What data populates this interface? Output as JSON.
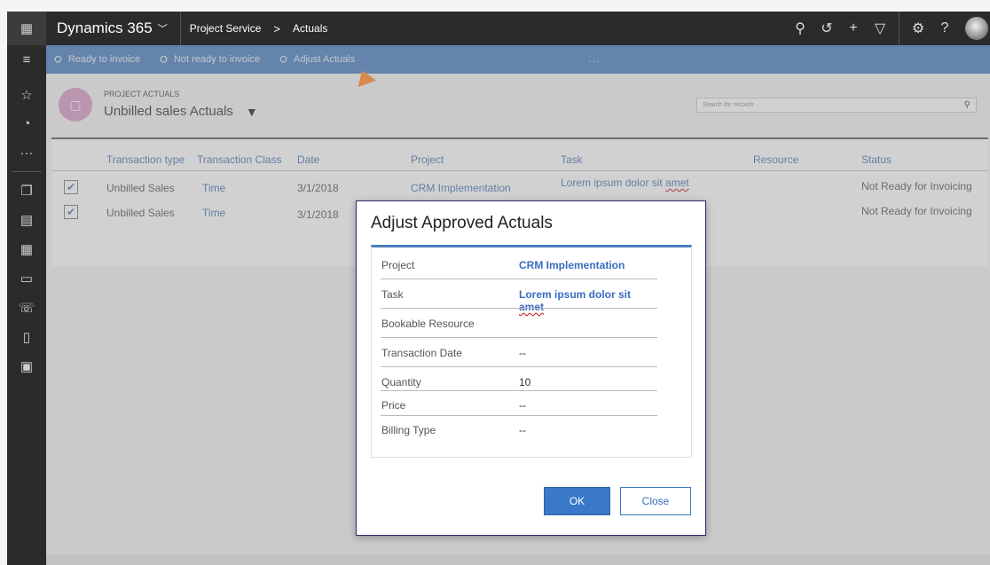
{
  "topbar": {
    "brand": "Dynamics 365",
    "brand_caret": "﹀",
    "breadcrumb": [
      "Project Service",
      "Actuals"
    ],
    "breadcrumb_sep": ">",
    "icons": [
      "search-icon",
      "history-icon",
      "plus-icon",
      "filter-icon",
      "settings-icon",
      "help-icon"
    ]
  },
  "commandbar": {
    "items": [
      {
        "label": "Ready to invoice"
      },
      {
        "label": "Not ready to invoice"
      },
      {
        "label": "Adjust Actuals"
      }
    ],
    "more": "..."
  },
  "header": {
    "entity_label": "PROJECT ACTUALS",
    "view_name": "Unbilled sales Actuals",
    "search_placeholder": "Search for records"
  },
  "grid": {
    "columns": [
      "Transaction type",
      "Transaction Class",
      "Date",
      "Project",
      "Task",
      "Resource",
      "Status"
    ],
    "rows": [
      {
        "checked": true,
        "type": "Unbilled Sales",
        "class": "Time",
        "date": "3/1/2018",
        "project": "CRM Implementation",
        "task_main": "Lorem ipsum dolor sit ",
        "task_wavy": "amet",
        "resource": "",
        "status": "Not Ready for Invoicing"
      },
      {
        "checked": true,
        "type": "Unbilled Sales",
        "class": "Time",
        "date": "3/1/2018",
        "project": "",
        "task_main": "",
        "task_wavy": "",
        "resource": "",
        "status": "Not Ready for Invoicing"
      }
    ]
  },
  "dialog": {
    "title": "Adjust Approved Actuals",
    "fields": [
      {
        "label": "Project",
        "value": "CRM Implementation",
        "blue": true
      },
      {
        "label": "Task",
        "value_main": "Lorem ipsum dolor sit ",
        "value_wavy": "amet",
        "blue": true
      },
      {
        "label": "Bookable Resource",
        "value": ""
      },
      {
        "label": "Transaction Date",
        "value": "--"
      },
      {
        "label": "Quantity",
        "value": "10"
      },
      {
        "label": "Price",
        "value": "--"
      },
      {
        "label": "Billing Type",
        "value": "--"
      }
    ],
    "ok_label": "OK",
    "close_label": "Close"
  },
  "colors": {
    "accent": "#4a7fc1",
    "nav_dark": "#2b2b2b",
    "link": "#4a76b5",
    "ok_button": "#3a78c9",
    "pointer": "#d8894e"
  }
}
